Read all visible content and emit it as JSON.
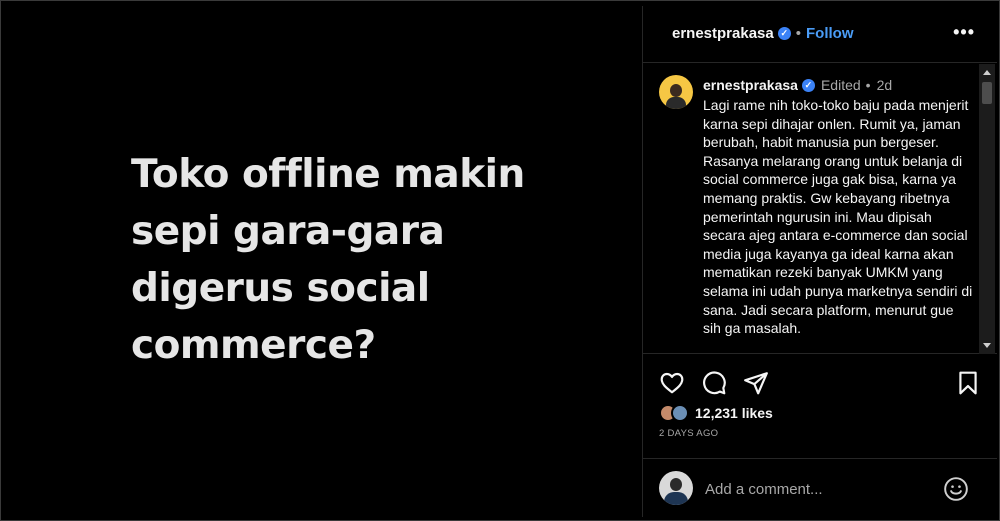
{
  "media": {
    "headline": "Toko offline makin sepi gara-gara digerus social commerce?"
  },
  "header": {
    "username": "ernestprakasa",
    "separator": "•",
    "follow_label": "Follow",
    "more_icon": "more-horizontal-icon"
  },
  "caption": {
    "username": "ernestprakasa",
    "edited": "Edited",
    "separator": "•",
    "age": "2d",
    "avatar_badge": "ernest",
    "text": "Lagi rame nih toko-toko baju pada menjerit karna sepi dihajar onlen. Rumit ya, jaman berubah, habit manusia pun bergeser. Rasanya melarang orang untuk belanja di social commerce juga gak bisa, karna ya memang praktis. Gw kebayang ribetnya pemerintah ngurusin ini. Mau dipisah secara ajeg antara e-commerce dan social media juga kayanya ga ideal karna akan mematikan rezeki banyak UMKM yang selama ini udah punya marketnya sendiri di sana. Jadi secara platform, menurut gue sih ga masalah."
  },
  "actions": {
    "like_icon": "heart-icon",
    "comment_icon": "comment-icon",
    "share_icon": "send-icon",
    "save_icon": "bookmark-icon"
  },
  "likes": {
    "count": "12,231 likes"
  },
  "timestamp": "2 DAYS AGO",
  "comment": {
    "placeholder": "Add a comment...",
    "emoji_icon": "smiley-icon"
  },
  "colors": {
    "background": "#000000",
    "accent": "#4a9cf6",
    "verified": "#3b82f6",
    "muted_text": "#a8a8a8"
  }
}
